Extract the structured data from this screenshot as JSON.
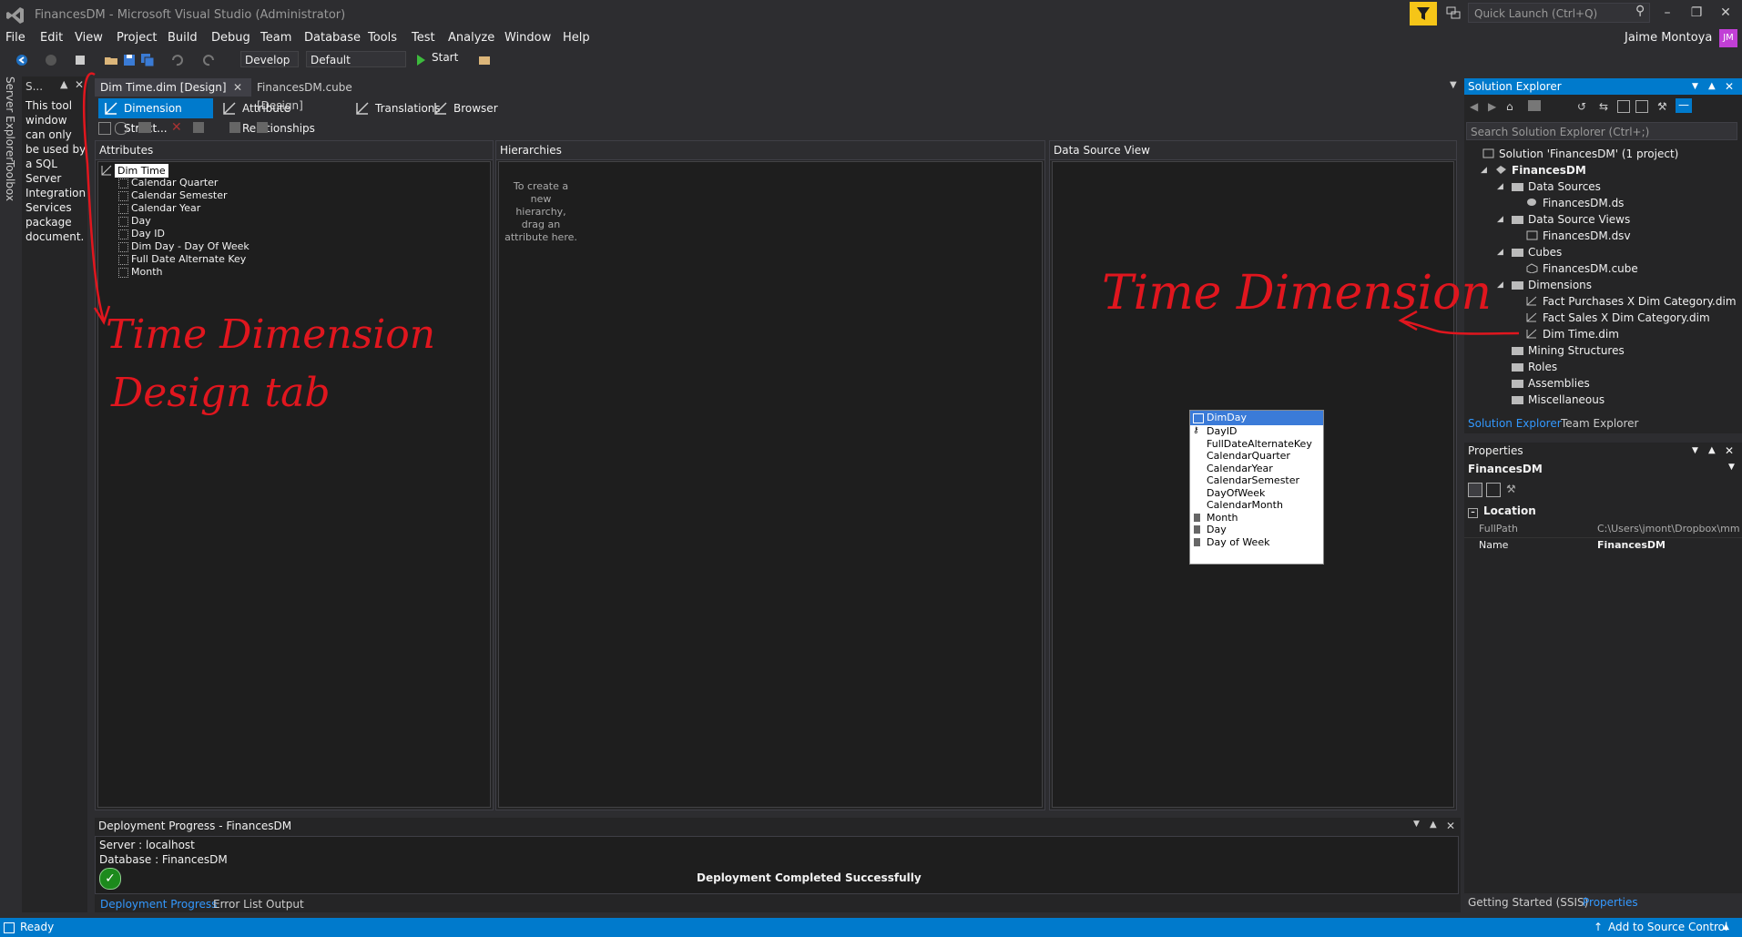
{
  "window": {
    "title": "FinancesDM - Microsoft Visual Studio  (Administrator)",
    "quick_launch_placeholder": "Quick Launch (Ctrl+Q)",
    "user_name": "Jaime Montoya",
    "user_initials": "JM"
  },
  "menu": [
    "File",
    "Edit",
    "View",
    "Project",
    "Build",
    "Debug",
    "Team",
    "Database",
    "Tools",
    "Test",
    "Analyze",
    "Window",
    "Help"
  ],
  "toolbar": {
    "configuration": "Develop",
    "platform": "Default",
    "start_label": "Start"
  },
  "side_tabs": [
    "Server Explorer",
    "Toolbox"
  ],
  "tool_panel": {
    "title": "S...",
    "message": "This tool window can only be used by a SQL Server Integration Services package document."
  },
  "doc_tabs": [
    "Dim Time.dim [Design]",
    "FinancesDM.cube [Design]"
  ],
  "designer_tabs": [
    "Dimension Struct...",
    "Attribute Relationships",
    "Translations",
    "Browser"
  ],
  "attributes_pane": {
    "header": "Attributes",
    "root": "Dim Time",
    "items": [
      "Calendar Quarter",
      "Calendar Semester",
      "Calendar Year",
      "Day",
      "Day ID",
      "Dim Day - Day Of Week",
      "Full Date Alternate Key",
      "Month"
    ]
  },
  "hierarchies_pane": {
    "header": "Hierarchies",
    "hint": "To create a new hierarchy, drag an attribute here."
  },
  "dsv_pane": {
    "header": "Data Source View",
    "table_name": "DimDay",
    "columns": [
      "DayID",
      "FullDateAlternateKey",
      "CalendarQuarter",
      "CalendarYear",
      "CalendarSemester",
      "DayOfWeek",
      "CalendarMonth",
      "Month",
      "Day",
      "Day of Week"
    ]
  },
  "solution_explorer": {
    "title": "Solution Explorer",
    "search_placeholder": "Search Solution Explorer (Ctrl+;)",
    "solution": "Solution 'FinancesDM' (1 project)",
    "project": "FinancesDM",
    "nodes": {
      "data_sources": "Data Sources",
      "ds_file": "FinancesDM.ds",
      "dsv": "Data Source Views",
      "dsv_file": "FinancesDM.dsv",
      "cubes": "Cubes",
      "cube_file": "FinancesDM.cube",
      "dimensions": "Dimensions",
      "dim1": "Fact Purchases X Dim Category.dim",
      "dim2": "Fact Sales X Dim Category.dim",
      "dim3": "Dim Time.dim",
      "mining": "Mining Structures",
      "roles": "Roles",
      "assemblies": "Assemblies",
      "misc": "Miscellaneous"
    },
    "bottom_tabs": [
      "Solution Explorer",
      "Team Explorer"
    ]
  },
  "properties": {
    "title": "Properties",
    "object": "FinancesDM",
    "category": "Location",
    "rows": [
      {
        "name": "FullPath",
        "value": "C:\\Users\\jmont\\Dropbox\\mm"
      },
      {
        "name": "Name",
        "value": "FinancesDM"
      }
    ],
    "bottom_tabs": [
      "Getting Started (SSIS)",
      "Properties"
    ]
  },
  "deployment": {
    "title": "Deployment Progress - FinancesDM",
    "server_line": "Server :  localhost",
    "database_line": "Database : FinancesDM",
    "status": "Deployment Completed Successfully",
    "tabs": [
      "Deployment Progress",
      "Error List",
      "Output"
    ]
  },
  "statusbar": {
    "left": "Ready",
    "right": "Add to Source Control"
  },
  "annotations": {
    "left_line1": "Time Dimension",
    "left_line2": "Design tab",
    "right": "Time Dimension"
  },
  "colors": {
    "accent": "#007acc",
    "annotation": "#e0161e",
    "background": "#2d2d30"
  }
}
